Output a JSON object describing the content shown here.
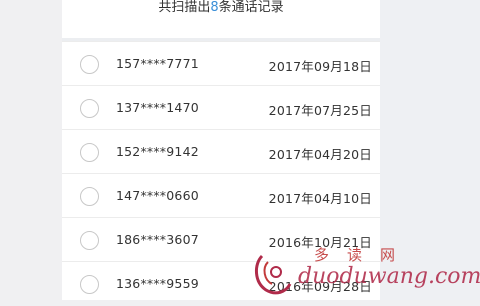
{
  "header": {
    "prefix": "共扫描出",
    "count": "8",
    "suffix": "条通话记录"
  },
  "records": [
    {
      "phone": "157****7771",
      "date": "2017年09月18日"
    },
    {
      "phone": "137****1470",
      "date": "2017年07月25日"
    },
    {
      "phone": "152****9142",
      "date": "2017年04月20日"
    },
    {
      "phone": "147****0660",
      "date": "2017年04月10日"
    },
    {
      "phone": "186****3607",
      "date": "2016年10月21日"
    },
    {
      "phone": "136****9559",
      "date": "2016年09月28日"
    }
  ],
  "watermark": {
    "cn": "多读网",
    "en": "duoduwang.com"
  },
  "colors": {
    "accent": "#3a8fd8",
    "watermark": "#b02b4a"
  }
}
